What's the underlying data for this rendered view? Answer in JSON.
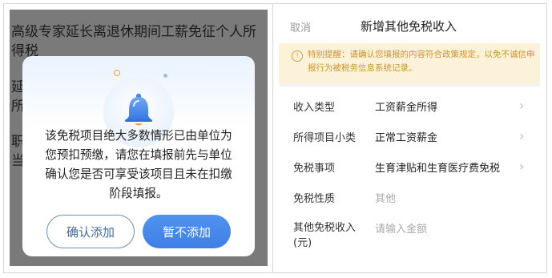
{
  "left_panel": {
    "background_lines": [
      "高级专家延长离退休期间工薪免征个人所",
      "得税",
      "延",
      "所",
      "职",
      "当"
    ],
    "modal": {
      "icon": "bell-icon",
      "message": "该免税项目绝大多数情形已由单位为您预扣预缴，请您在填报前先与单位确认您是否可享受该项目且未在扣缴阶段填报。",
      "confirm_label": "确认添加",
      "cancel_label": "暂不添加"
    }
  },
  "right_panel": {
    "nav": {
      "cancel_label": "取消",
      "title": "新增其他免税收入"
    },
    "notice": {
      "icon": "info-icon",
      "text": "特别提醒：请确认您填报的内容符合政策规定，以免不诚信申报行为被税务信息系统记录。"
    },
    "form": {
      "rows": [
        {
          "label": "收入类型",
          "value": "工资薪金所得"
        },
        {
          "label": "所得项目小类",
          "value": "正常工资薪金"
        },
        {
          "label": "免税事项",
          "value": "生育津贴和生育医疗费免税"
        },
        {
          "label": "免税性质",
          "value": "其他"
        },
        {
          "label": "其他免税收入(元)",
          "placeholder": "请输入金额"
        }
      ]
    }
  },
  "colors": {
    "primary_blue": "#3f7fe6",
    "notice_bg": "#fcf1d9",
    "notice_text": "#c99632",
    "overlay_gray": "#7a7a7a"
  }
}
